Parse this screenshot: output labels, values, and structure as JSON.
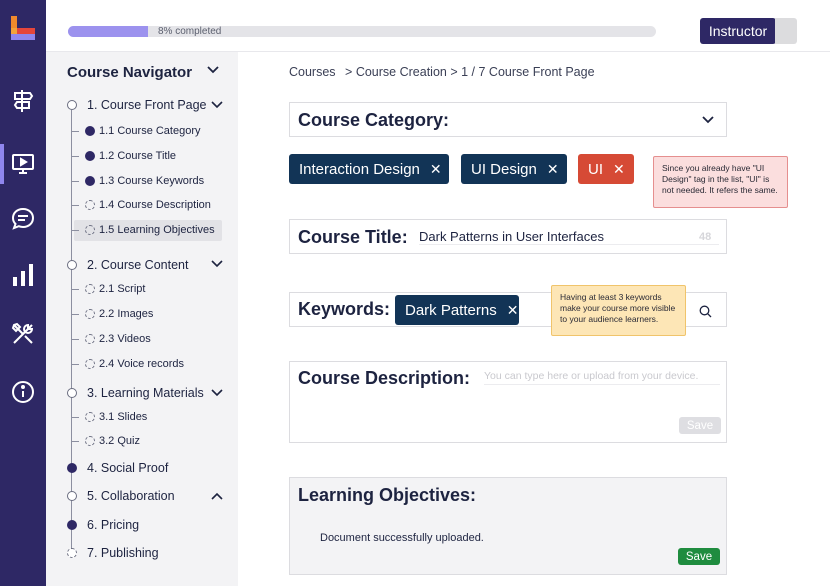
{
  "topbar": {
    "progress_text": "8% completed",
    "progress_fraction": 0.136,
    "role_button": "Instructor"
  },
  "rail": {
    "icons": [
      "logo-icon",
      "signpost-icon",
      "presentation-icon",
      "chat-icon",
      "bar-chart-icon",
      "tools-icon",
      "info-icon"
    ]
  },
  "navigator": {
    "title": "Course Navigator",
    "sections": [
      {
        "label": "1. Course Front Page",
        "state": "in-progress",
        "expanded": true,
        "items": [
          {
            "label": "1.1 Course Category",
            "done": true
          },
          {
            "label": "1.2 Course Title",
            "done": true
          },
          {
            "label": "1.3 Course Keywords",
            "done": true
          },
          {
            "label": "1.4 Course Description",
            "done": false
          },
          {
            "label": "1.5 Learning Objectives",
            "done": false,
            "selected": true
          }
        ]
      },
      {
        "label": "2. Course Content",
        "state": "in-progress",
        "expanded": true,
        "items": [
          {
            "label": "2.1 Script",
            "done": false
          },
          {
            "label": "2.2 Images",
            "done": false
          },
          {
            "label": "2.3 Videos",
            "done": false
          },
          {
            "label": "2.4 Voice records",
            "done": false
          }
        ]
      },
      {
        "label": "3. Learning Materials",
        "state": "in-progress",
        "expanded": true,
        "items": [
          {
            "label": "3.1 Slides",
            "done": false
          },
          {
            "label": "3.2 Quiz",
            "done": false
          }
        ]
      },
      {
        "label": "4. Social Proof",
        "state": "done"
      },
      {
        "label": "5. Collaboration",
        "state": "in-progress",
        "collapsible": "up"
      },
      {
        "label": "6. Pricing",
        "state": "done"
      },
      {
        "label": "7. Publishing",
        "state": "todo"
      }
    ]
  },
  "breadcrumb": {
    "items": [
      "Courses",
      "Course Creation",
      "1 / 7 Course Front Page"
    ],
    "sep": ">"
  },
  "category": {
    "label": "Course Category:",
    "tags": [
      {
        "text": "Interaction Design",
        "variant": "navy"
      },
      {
        "text": "UI Design",
        "variant": "navy"
      },
      {
        "text": "UI",
        "variant": "red"
      }
    ],
    "warning": "Since you already have \"UI Design\" tag in the list, \"UI\" is not needed. It refers the same."
  },
  "title_field": {
    "label": "Course Title:",
    "value": "Dark Patterns in User Interfaces",
    "remaining": "48"
  },
  "keywords": {
    "label": "Keywords:",
    "tags": [
      {
        "text": "Dark Patterns",
        "variant": "navy"
      }
    ],
    "hint": "Having at least 3 keywords make your course more visible to your audience learners."
  },
  "description": {
    "label": "Course Description:",
    "placeholder": "You can type here or upload from your device.",
    "save": "Save"
  },
  "objectives": {
    "label": "Learning Objectives:",
    "message": "Document successfully uploaded.",
    "save": "Save"
  },
  "colors": {
    "rail": "#2e2865",
    "accent": "#9c92ee",
    "tag_navy": "#123456",
    "tag_red": "#d64a35",
    "save_green": "#1f8c3f"
  }
}
